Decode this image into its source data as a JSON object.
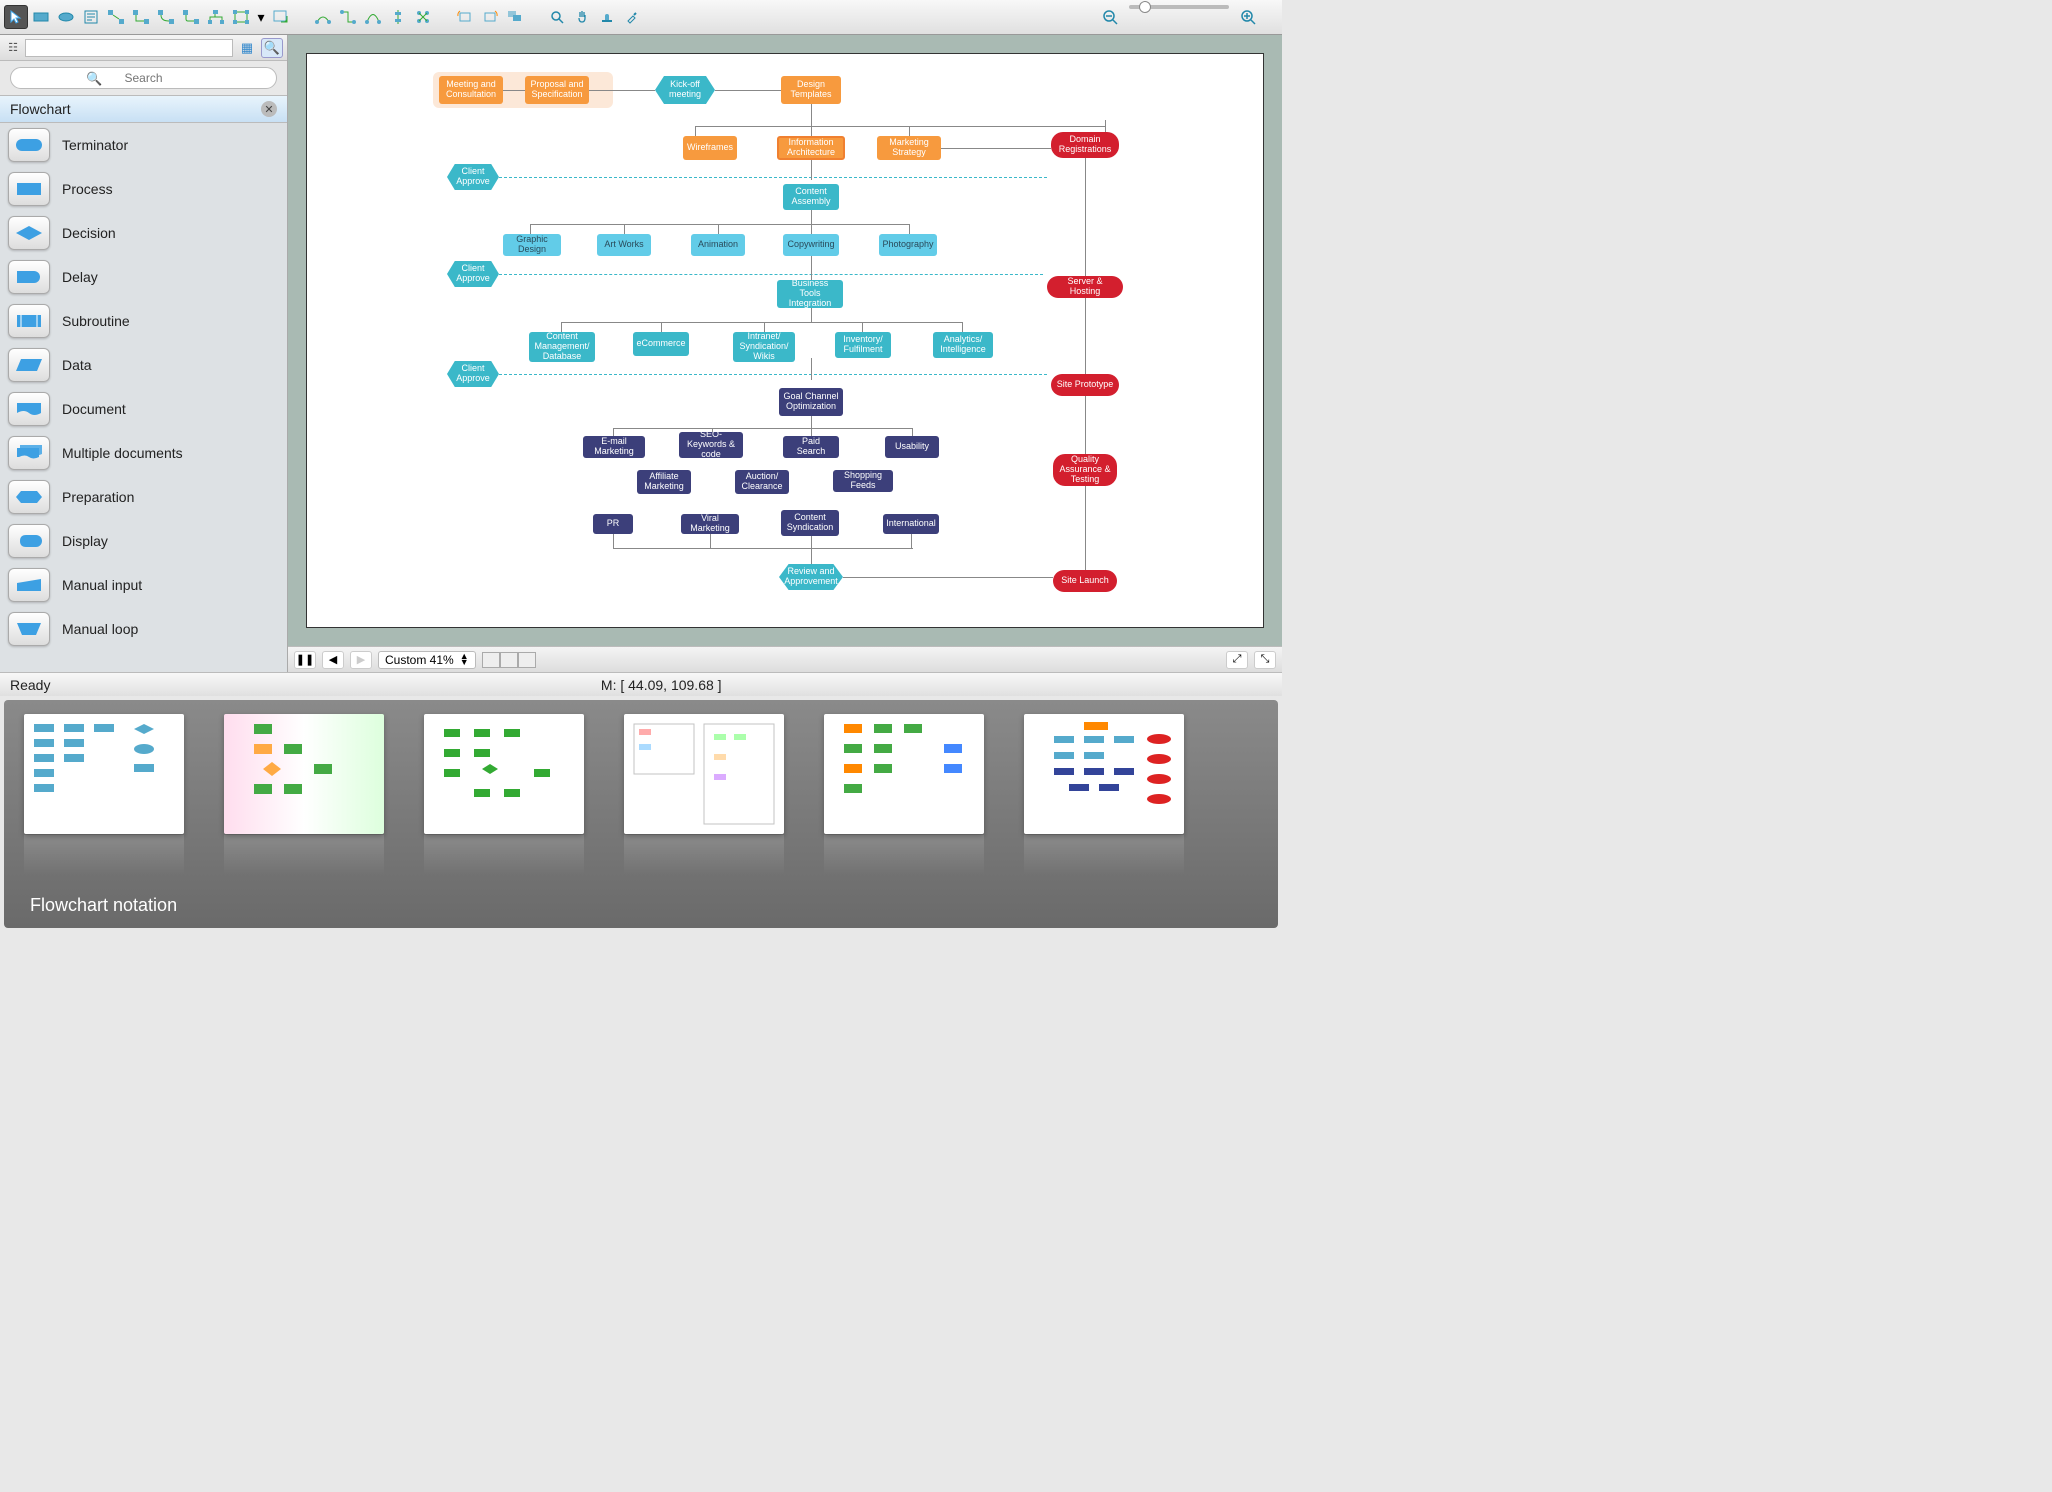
{
  "toolbar": {
    "groups": [
      [
        "pointer",
        "rect",
        "ellipse",
        "text",
        "conn-line",
        "conn-curve",
        "conn-angle",
        "conn-round",
        "conn-tree",
        "conn-multi",
        "chevron-down",
        "box-plus"
      ],
      [
        "curve-conn",
        "angle-conn",
        "bezier-conn",
        "align-v",
        "align-h"
      ],
      [
        "rotate-left",
        "rotate-right",
        "group"
      ],
      [
        "zoom",
        "pan",
        "layers",
        "eyedrop"
      ]
    ],
    "active_tool": "pointer"
  },
  "lp_header": {
    "search_btn": "🔍"
  },
  "search": {
    "placeholder": "Search"
  },
  "section_title": "Flowchart",
  "shapes": [
    {
      "id": "terminator",
      "label": "Terminator"
    },
    {
      "id": "process",
      "label": "Process"
    },
    {
      "id": "decision",
      "label": "Decision"
    },
    {
      "id": "delay",
      "label": "Delay"
    },
    {
      "id": "subroutine",
      "label": "Subroutine"
    },
    {
      "id": "data",
      "label": "Data"
    },
    {
      "id": "document",
      "label": "Document"
    },
    {
      "id": "multidoc",
      "label": "Multiple documents"
    },
    {
      "id": "preparation",
      "label": "Preparation"
    },
    {
      "id": "display",
      "label": "Display"
    },
    {
      "id": "minput",
      "label": "Manual input"
    },
    {
      "id": "mloop",
      "label": "Manual loop"
    }
  ],
  "canvas_footer": {
    "zoom_label": "Custom 41%",
    "stepper": "⌃⌄"
  },
  "status": {
    "ready": "Ready",
    "coords_label": "M: [ 44.09, 109.68 ]"
  },
  "gallery": {
    "title": "Flowchart notation"
  },
  "flow": {
    "r1": {
      "meeting": "Meeting and Consultation",
      "proposal": "Proposal and Specification",
      "kickoff": "Kick-off meeting",
      "design": "Design Templates"
    },
    "r2": {
      "wire": "Wireframes",
      "info": "Information Architecture",
      "mktg": "Marketing Strategy",
      "domain": "Domain Registrations"
    },
    "approve": "Client Approve",
    "r3": {
      "assembly": "Content Assembly"
    },
    "r4": {
      "gd": "Graphic Design",
      "art": "Art Works",
      "anim": "Animation",
      "copy": "Copywriting",
      "photo": "Photography"
    },
    "server": "Server & Hosting",
    "r5": {
      "btools": "Business Tools Integration"
    },
    "r6": {
      "cmdb": "Content Management/ Database",
      "ecom": "eCommerce",
      "intra": "Intranet/ Syndication/ Wikis",
      "inv": "Inventory/ Fulfilment",
      "ana": "Analytics/ Intelligence"
    },
    "proto": "Site Prototype",
    "r7": {
      "goal": "Goal Channel Optimization"
    },
    "r8": {
      "email": "E-mail Marketing",
      "seo": "SEO-Keywords & code",
      "paid": "Paid Search",
      "usab": "Usability"
    },
    "r8b": {
      "aff": "Affiliate Marketing",
      "auc": "Auction/ Clearance",
      "feeds": "Shopping Feeds"
    },
    "qa": "Quality Assurance & Testing",
    "r9": {
      "pr": "PR",
      "viral": "Viral Marketing",
      "csynd": "Content Syndication",
      "intl": "International"
    },
    "r10": {
      "review": "Review and Approvement",
      "launch": "Site Launch"
    }
  }
}
